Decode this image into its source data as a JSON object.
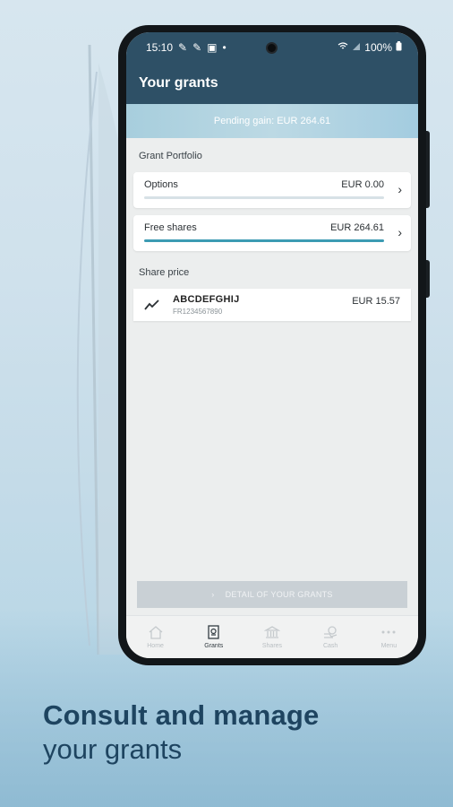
{
  "status_bar": {
    "time": "15:10",
    "battery": "100%"
  },
  "app": {
    "title": "Your grants"
  },
  "pending_gain": "Pending gain: EUR 264.61",
  "portfolio": {
    "label": "Grant Portfolio",
    "items": [
      {
        "name": "Options",
        "amount": "EUR 0.00",
        "progress": 0.0
      },
      {
        "name": "Free shares",
        "amount": "EUR 264.61",
        "progress": 1.0
      }
    ]
  },
  "share_price": {
    "label": "Share price",
    "ticker": "ABCDEFGHIJ",
    "isin": "FR1234567890",
    "price": "EUR 15.57",
    "icon": "trend-icon"
  },
  "detail_button": "DETAIL OF YOUR GRANTS",
  "nav": [
    {
      "label": "Home",
      "icon": "home-icon"
    },
    {
      "label": "Grants",
      "icon": "grants-icon"
    },
    {
      "label": "Shares",
      "icon": "bank-icon"
    },
    {
      "label": "Cash",
      "icon": "cash-icon"
    },
    {
      "label": "Menu",
      "icon": "more-icon"
    }
  ],
  "headline": {
    "line1": "Consult and manage",
    "line2": "your grants"
  },
  "colors": {
    "primary": "#2e5066",
    "accent": "#3c9bb3",
    "headline": "#1e4460"
  }
}
